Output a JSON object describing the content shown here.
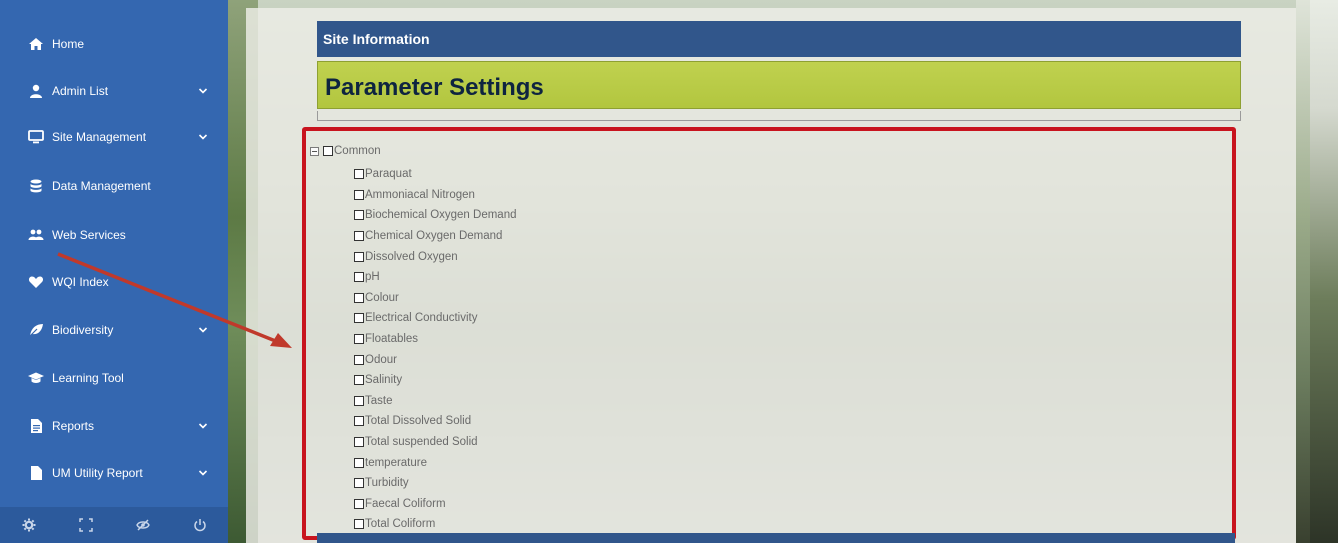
{
  "sidebar": {
    "items": [
      {
        "label": "Home",
        "icon": "home-icon",
        "has_submenu": false
      },
      {
        "label": "Admin List",
        "icon": "user-icon",
        "has_submenu": true
      },
      {
        "label": "Site Management",
        "icon": "monitor-icon",
        "has_submenu": true
      },
      {
        "label": "Data Management",
        "icon": "database-icon",
        "has_submenu": false
      },
      {
        "label": "Web Services",
        "icon": "users-icon",
        "has_submenu": false
      },
      {
        "label": "WQI Index",
        "icon": "heart-icon",
        "has_submenu": false
      },
      {
        "label": "Biodiversity",
        "icon": "leaf-icon",
        "has_submenu": true
      },
      {
        "label": "Learning Tool",
        "icon": "graduation-cap-icon",
        "has_submenu": false
      },
      {
        "label": "Reports",
        "icon": "file-text-icon",
        "has_submenu": true
      },
      {
        "label": "UM Utility Report",
        "icon": "file-icon",
        "has_submenu": true
      }
    ],
    "footer_icons": [
      "gear-icon",
      "fullscreen-icon",
      "eye-slash-icon",
      "power-icon"
    ]
  },
  "main": {
    "site_info_title": "Site Information",
    "page_title": "Parameter Settings"
  },
  "parameter_tree": {
    "root": {
      "label": "Common",
      "expanded": true,
      "checked": false
    },
    "children": [
      {
        "label": "Paraquat",
        "checked": false
      },
      {
        "label": "Ammoniacal Nitrogen",
        "checked": false
      },
      {
        "label": "Biochemical Oxygen Demand",
        "checked": false
      },
      {
        "label": "Chemical Oxygen Demand",
        "checked": false
      },
      {
        "label": "Dissolved Oxygen",
        "checked": false
      },
      {
        "label": "pH",
        "checked": false
      },
      {
        "label": "Colour",
        "checked": false
      },
      {
        "label": "Electrical Conductivity",
        "checked": false
      },
      {
        "label": "Floatables",
        "checked": false
      },
      {
        "label": "Odour",
        "checked": false
      },
      {
        "label": "Salinity",
        "checked": false
      },
      {
        "label": "Taste",
        "checked": false
      },
      {
        "label": "Total Dissolved Solid",
        "checked": false
      },
      {
        "label": "Total suspended Solid",
        "checked": false
      },
      {
        "label": "temperature",
        "checked": false
      },
      {
        "label": "Turbidity",
        "checked": false
      },
      {
        "label": "Faecal Coliform",
        "checked": false
      },
      {
        "label": "Total Coliform",
        "checked": false
      }
    ]
  },
  "colors": {
    "sidebar_bg": "#3467b0",
    "header_bar": "#31568b",
    "title_band": "#b8cb45",
    "highlight_border": "#c8141e",
    "annotation_arrow": "#c0392b"
  }
}
